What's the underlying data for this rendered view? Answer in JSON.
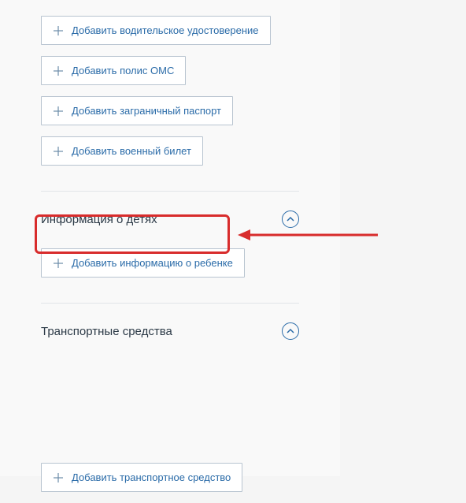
{
  "documents": {
    "add_driver_license": "Добавить водительское удостоверение",
    "add_oms_policy": "Добавить полис ОМС",
    "add_foreign_passport": "Добавить заграничный паспорт",
    "add_military_id": "Добавить военный билет"
  },
  "sections": {
    "children": {
      "title": "Информация о детях",
      "add_child_info": "Добавить информацию о ребенке"
    },
    "vehicles": {
      "title": "Транспортные средства",
      "add_vehicle": "Добавить транспортное средство"
    }
  },
  "colors": {
    "link": "#2a6ba8",
    "border": "#b8c4d0",
    "highlight": "#d82c2c",
    "text": "#2c3a47"
  }
}
